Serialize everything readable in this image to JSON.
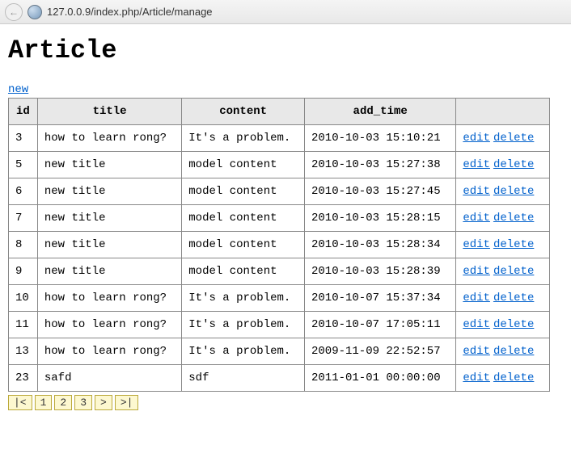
{
  "browser": {
    "url": "127.0.0.9/index.php/Article/manage"
  },
  "page": {
    "heading": "Article",
    "new_link": "new"
  },
  "table": {
    "headers": {
      "id": "id",
      "title": "title",
      "content": "content",
      "add_time": "add_time",
      "actions": ""
    },
    "actions": {
      "edit": "edit",
      "delete": "delete"
    },
    "rows": [
      {
        "id": "3",
        "title": "how to learn rong?",
        "content": "It's a problem.",
        "add_time": "2010-10-03 15:10:21"
      },
      {
        "id": "5",
        "title": "new title",
        "content": "model content",
        "add_time": "2010-10-03 15:27:38"
      },
      {
        "id": "6",
        "title": "new title",
        "content": "model content",
        "add_time": "2010-10-03 15:27:45"
      },
      {
        "id": "7",
        "title": "new title",
        "content": "model content",
        "add_time": "2010-10-03 15:28:15"
      },
      {
        "id": "8",
        "title": "new title",
        "content": "model content",
        "add_time": "2010-10-03 15:28:34"
      },
      {
        "id": "9",
        "title": "new title",
        "content": "model content",
        "add_time": "2010-10-03 15:28:39"
      },
      {
        "id": "10",
        "title": "how to learn rong?",
        "content": "It's a problem.",
        "add_time": "2010-10-07 15:37:34"
      },
      {
        "id": "11",
        "title": "how to learn rong?",
        "content": "It's a problem.",
        "add_time": "2010-10-07 17:05:11"
      },
      {
        "id": "13",
        "title": "how to learn rong?",
        "content": "It's a problem.",
        "add_time": "2009-11-09 22:52:57"
      },
      {
        "id": "23",
        "title": "safd",
        "content": "sdf",
        "add_time": "2011-01-01 00:00:00"
      }
    ]
  },
  "pager": {
    "first": "|<",
    "pages": [
      "1",
      "2",
      "3"
    ],
    "next": ">",
    "last": ">|"
  }
}
